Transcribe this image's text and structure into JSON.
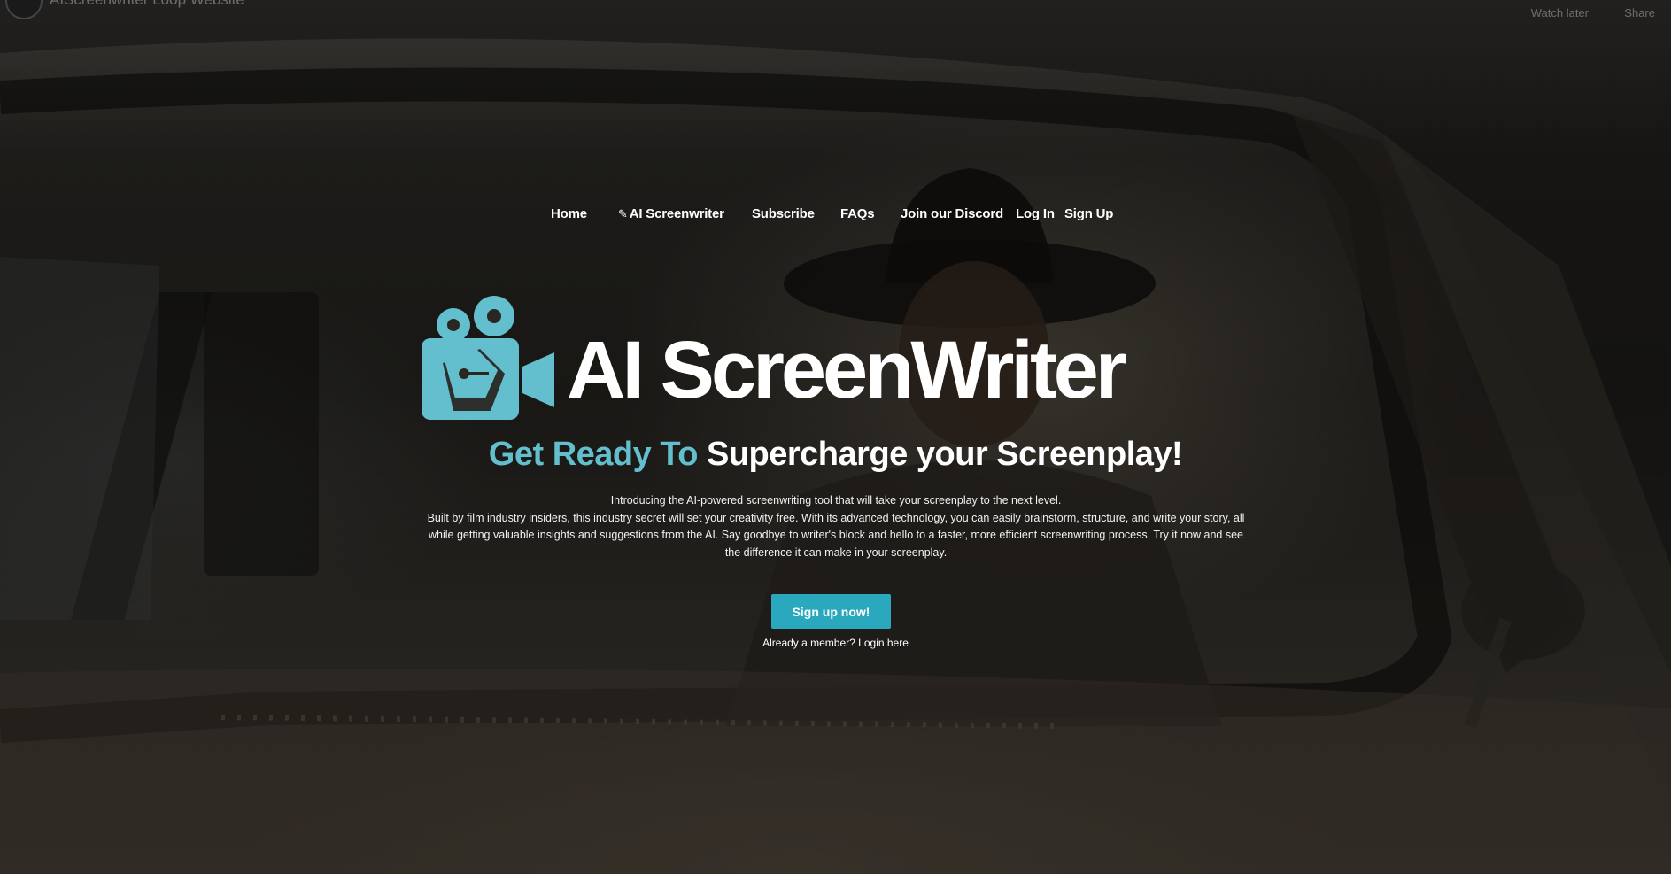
{
  "video_header": {
    "title": "AIScreenwriter Loop Website",
    "watch_later": "Watch later",
    "share": "Share"
  },
  "nav": {
    "items": [
      {
        "label": "Home"
      },
      {
        "label": "AI Screenwriter",
        "icon": "pencil-icon"
      },
      {
        "label": "Subscribe"
      },
      {
        "label": "FAQs"
      },
      {
        "label": "Join our Discord"
      },
      {
        "label": "Log In"
      },
      {
        "label": "Sign Up"
      }
    ]
  },
  "logo": {
    "text": "AI ScreenWriter",
    "icon": "film-camera-pen-icon",
    "color": "#63bfcd"
  },
  "headline": {
    "accent": "Get Ready To",
    "main": "Supercharge your Screenplay!"
  },
  "intro": {
    "line1": "Introducing the AI-powered screenwriting tool that will take your screenplay to the next level.",
    "line2": "Built by film industry insiders, this industry secret will set your creativity free. With its advanced technology, you can easily brainstorm, structure, and write your story, all while getting valuable insights and suggestions from the AI. Say goodbye to writer's block and hello to a faster, more efficient screenwriting process. Try it now and see the difference it can make in your screenplay."
  },
  "cta": {
    "label": "Sign up now!",
    "member_text": "Already a member?",
    "login_link": "Login here",
    "color": "#2aa8bd"
  }
}
